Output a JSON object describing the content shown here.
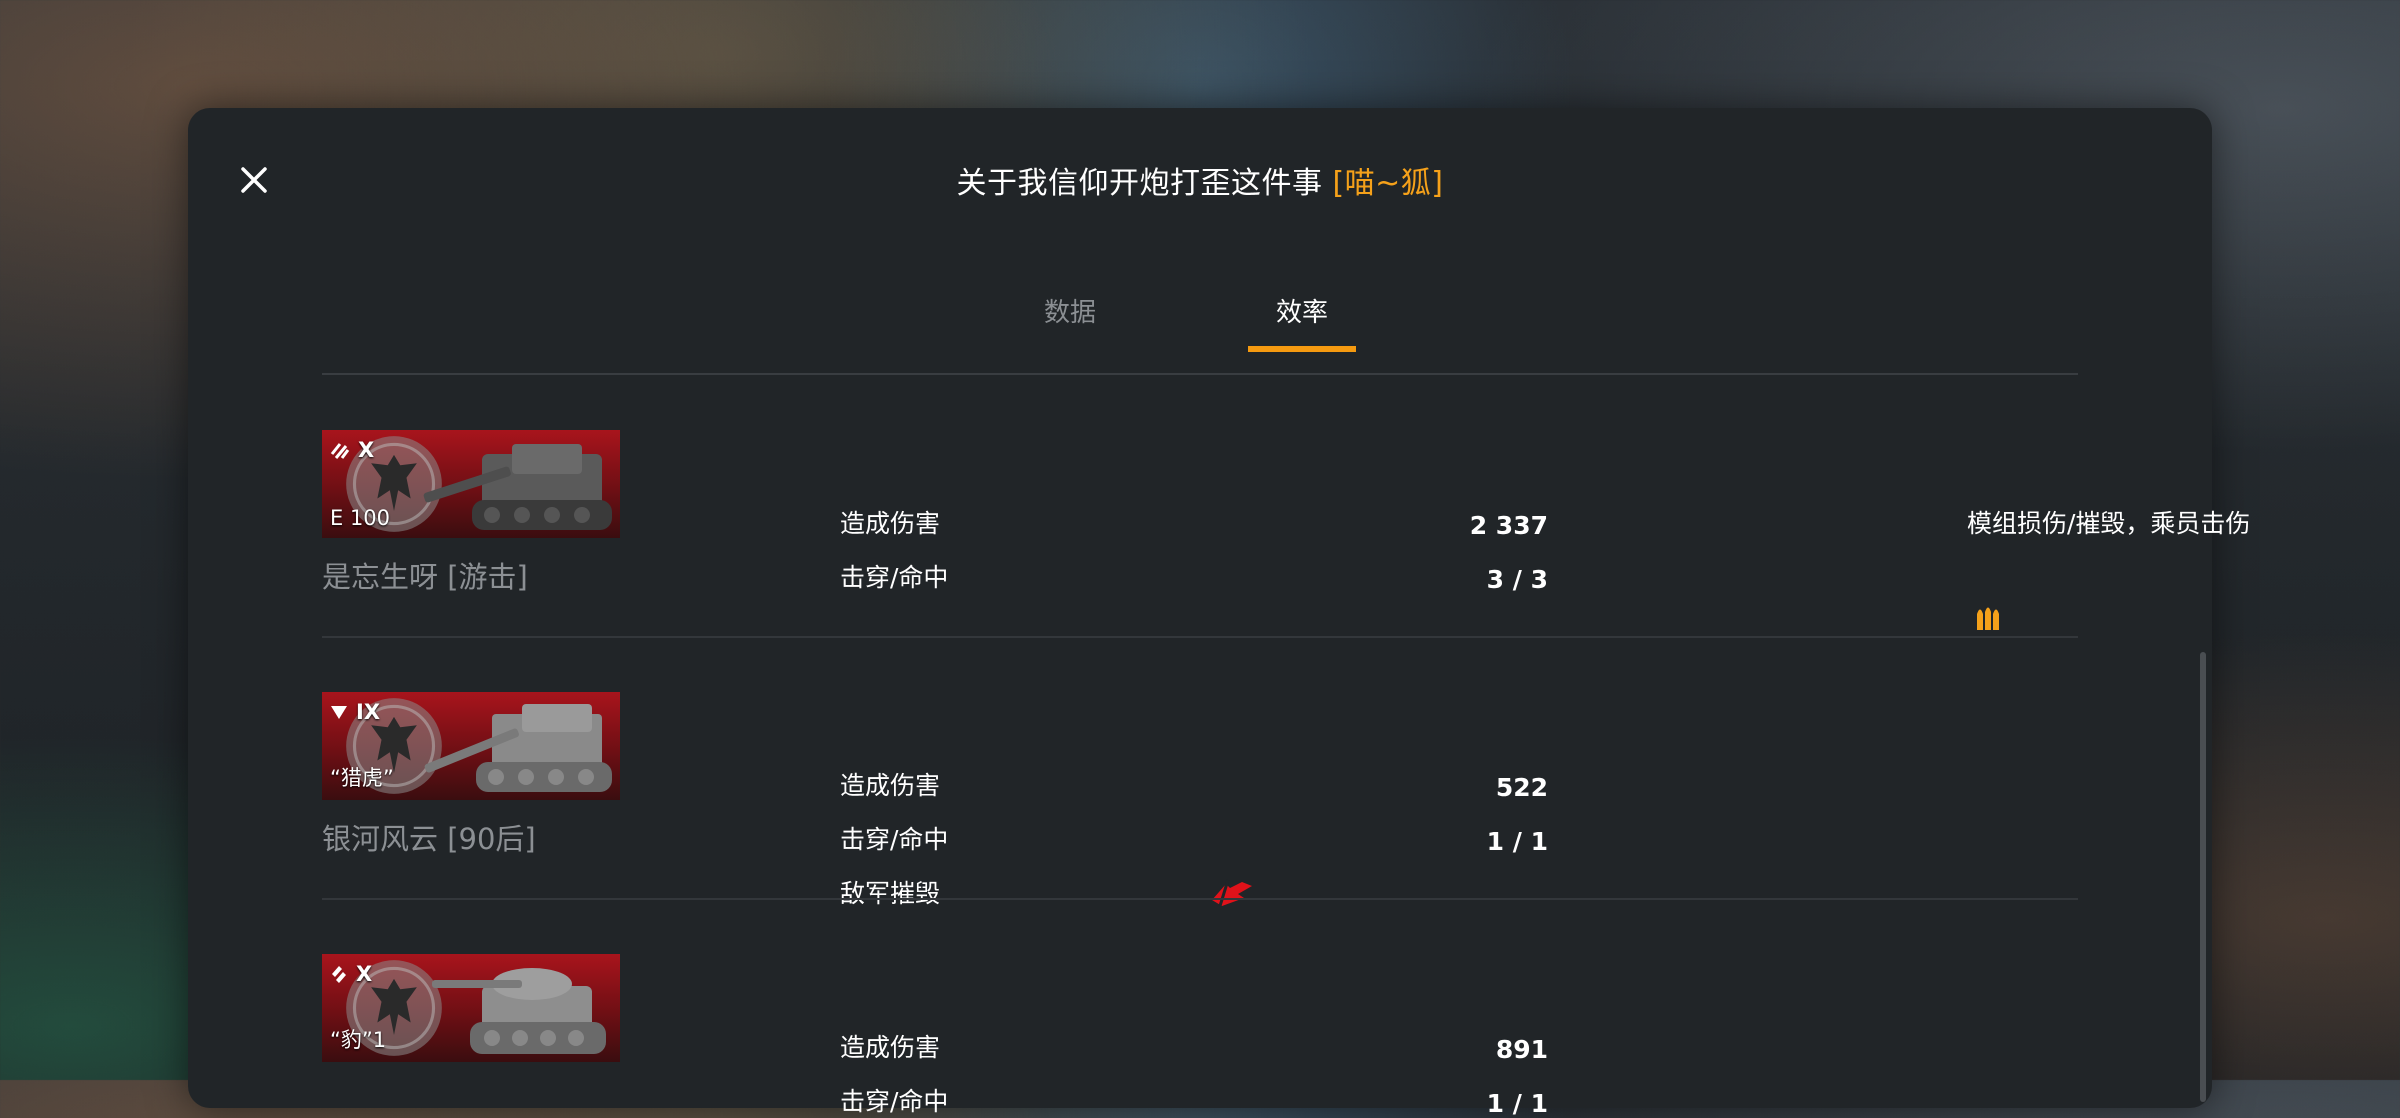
{
  "dialog": {
    "title": "关于我信仰开炮打歪这件事",
    "clan_tag": "[喵~狐]",
    "close_icon": "close-icon"
  },
  "tabs": [
    {
      "label": "数据",
      "active": false
    },
    {
      "label": "效率",
      "active": true
    }
  ],
  "colors": {
    "accent": "#f59a10",
    "banner_red": "#a8141c",
    "destroyed_icon": "#e0121a"
  },
  "rows": [
    {
      "tier": "X",
      "tier_icon": "tank-destroyer-icon",
      "tank": "E 100",
      "player": "是忘生呀 [游击]",
      "damage_label": "造成伤害",
      "damage_value": "2 337",
      "pen_label": "击穿/命中",
      "pen_value": "3 / 3",
      "extra_label": "模组损伤/摧毁，乘员击伤",
      "extra_icon": "shells-icon"
    },
    {
      "tier": "IX",
      "tier_icon": "tank-destroyer-icon",
      "tank": "“猎虎”",
      "player": "银河风云 [90后]",
      "damage_label": "造成伤害",
      "damage_value": "522",
      "pen_label": "击穿/命中",
      "pen_value": "1 / 1",
      "kill_label": "敌军摧毁",
      "kill_icon": "destroyed-tank-icon"
    },
    {
      "tier": "X",
      "tier_icon": "medium-tank-icon",
      "tank": "“豹”1",
      "damage_label": "造成伤害",
      "damage_value": "891",
      "pen_label": "击穿/命中",
      "pen_value": "1 / 1"
    }
  ]
}
